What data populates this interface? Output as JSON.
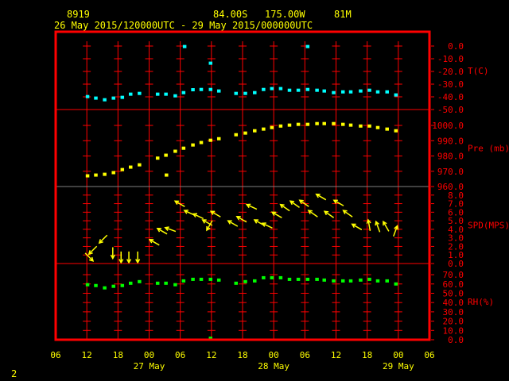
{
  "header": {
    "station": "8919",
    "latitude": "84.00S",
    "longitude": "175.00W",
    "elevation": "81M",
    "time_range": "26 May 2015/120000UTC - 29 May 2015/000000UTC"
  },
  "footer": {
    "page": "2"
  },
  "colors": {
    "frame": "#ff0000",
    "text": "#ffff00",
    "temp": "#00ffff",
    "pres": "#ffff00",
    "wind": "#ffff00",
    "rh": "#00ff00",
    "separator_gray": "#808080"
  },
  "chart_data": {
    "type": "scatter",
    "x_unit": "hours since 26 May 2015 06UTC",
    "xlim": [
      0,
      72
    ],
    "x_ticks": [
      0,
      6,
      12,
      18,
      24,
      30,
      36,
      42,
      48,
      54,
      60,
      66,
      72
    ],
    "x_tick_labels": [
      "06",
      "12",
      "18",
      "00",
      "06",
      "12",
      "18",
      "00",
      "06",
      "12",
      "18",
      "00",
      "06"
    ],
    "date_labels": [
      {
        "hour": 18,
        "label": "27 May"
      },
      {
        "hour": 42,
        "label": "28 May"
      },
      {
        "hour": 66,
        "label": "29 May"
      }
    ],
    "panels": [
      {
        "name": "temperature",
        "label": "T(C)",
        "ylim": [
          -50,
          11.25
        ],
        "color": "#00ffff",
        "ticks": [
          0,
          -10,
          -20,
          -30,
          -40,
          -50
        ],
        "tick_labels": [
          "0.0",
          "-10.0",
          "-20.0",
          "-30.0",
          "-40.0",
          "-50.0"
        ],
        "points": [
          [
            6.1,
            -39.8
          ],
          [
            7.7,
            -41
          ],
          [
            9.4,
            -42.3
          ],
          [
            11.1,
            -41
          ],
          [
            12.8,
            -40.4
          ],
          [
            14.4,
            -37.9
          ],
          [
            16.1,
            -37.3
          ],
          [
            19.6,
            -37.9
          ],
          [
            21.2,
            -37.9
          ],
          [
            23,
            -39.2
          ],
          [
            24.6,
            -36.7
          ],
          [
            26.4,
            -34.4
          ],
          [
            28,
            -34.2
          ],
          [
            29.8,
            -34.2
          ],
          [
            31.4,
            -35.4
          ],
          [
            34.7,
            -37.3
          ],
          [
            36.5,
            -37.3
          ],
          [
            38.3,
            -36.7
          ],
          [
            40,
            -34.2
          ],
          [
            41.6,
            -33.5
          ],
          [
            43.3,
            -33.5
          ],
          [
            45,
            -34.8
          ],
          [
            46.7,
            -34.8
          ],
          [
            48.5,
            -34.2
          ],
          [
            50.3,
            -34.8
          ],
          [
            51.7,
            -35.4
          ],
          [
            53.5,
            -36.7
          ],
          [
            55.3,
            -36.1
          ],
          [
            56.8,
            -36.1
          ],
          [
            58.7,
            -35.4
          ],
          [
            60.4,
            -34.8
          ],
          [
            62,
            -36.1
          ],
          [
            63.8,
            -36.1
          ],
          [
            65.5,
            -38.5
          ],
          [
            24.8,
            -0.4
          ],
          [
            29.8,
            -13.5
          ],
          [
            48.5,
            -0.4
          ]
        ]
      },
      {
        "name": "pressure",
        "label": "Pre (mb)",
        "ylim": [
          960,
          1010.4
        ],
        "color": "#ffff00",
        "ticks": [
          1000,
          990,
          980,
          970,
          960
        ],
        "tick_labels": [
          "1000.0",
          "990.0",
          "980.0",
          "970.0",
          "960.0"
        ],
        "points": [
          [
            6.1,
            967.0
          ],
          [
            7.7,
            967.5
          ],
          [
            9.4,
            968.0
          ],
          [
            11.1,
            969.1
          ],
          [
            12.8,
            971.1
          ],
          [
            14.4,
            972.7
          ],
          [
            16.1,
            974.2
          ],
          [
            19.6,
            978.6
          ],
          [
            21.2,
            980.5
          ],
          [
            23,
            983.1
          ],
          [
            24.6,
            985.1
          ],
          [
            26.4,
            987.2
          ],
          [
            28,
            988.8
          ],
          [
            29.8,
            990.3
          ],
          [
            31.4,
            991.3
          ],
          [
            34.7,
            993.9
          ],
          [
            36.5,
            995.0
          ],
          [
            38.3,
            996.5
          ],
          [
            40,
            997.6
          ],
          [
            41.6,
            998.6
          ],
          [
            43.3,
            999.6
          ],
          [
            45,
            1000.2
          ],
          [
            46.7,
            1000.7
          ],
          [
            48.5,
            1000.7
          ],
          [
            50.3,
            1001.2
          ],
          [
            51.7,
            1001.2
          ],
          [
            53.5,
            1001.2
          ],
          [
            55.3,
            1000.7
          ],
          [
            56.8,
            1000.2
          ],
          [
            58.7,
            999.6
          ],
          [
            60.4,
            999.6
          ],
          [
            62,
            998.6
          ],
          [
            63.8,
            997.6
          ],
          [
            65.5,
            996.5
          ],
          [
            21.3,
            967.5
          ]
        ]
      },
      {
        "name": "wind_speed",
        "label": "SPD(MPS)",
        "ylim": [
          0,
          9
        ],
        "color": "#ffff00",
        "ticks": [
          8,
          7,
          6,
          5,
          4,
          3,
          2,
          1,
          0
        ],
        "tick_labels": [
          "8.0",
          "7.0",
          "6.0",
          "5.0",
          "4.0",
          "3.0",
          "2.0",
          "1.0",
          "0.0"
        ],
        "points": [
          [
            6.4,
            1.1,
            225
          ],
          [
            8.4,
            2.4,
            225
          ],
          [
            7.2,
            0.3,
            135
          ],
          [
            11.0,
            0.6,
            180
          ],
          [
            12.6,
            0.1,
            180
          ],
          [
            14.1,
            0.1,
            180
          ],
          [
            15.8,
            0.1,
            180
          ],
          [
            18.1,
            2.8,
            300
          ],
          [
            19.6,
            4.1,
            300
          ],
          [
            21.1,
            4.2,
            290
          ],
          [
            23.0,
            7.3,
            300
          ],
          [
            24.8,
            6.2,
            295
          ],
          [
            26.5,
            5.8,
            295
          ],
          [
            28.3,
            5.1,
            300
          ],
          [
            29.1,
            3.9,
            210
          ],
          [
            29.9,
            6.1,
            300
          ],
          [
            33.2,
            5.0,
            300
          ],
          [
            34.9,
            5.5,
            300
          ],
          [
            36.8,
            6.9,
            295
          ],
          [
            38.3,
            5.1,
            300
          ],
          [
            39.8,
            4.7,
            295
          ],
          [
            41.7,
            6.0,
            300
          ],
          [
            43.3,
            6.9,
            305
          ],
          [
            45.2,
            7.3,
            305
          ],
          [
            47.0,
            7.4,
            305
          ],
          [
            48.7,
            6.2,
            305
          ],
          [
            50.2,
            8.1,
            300
          ],
          [
            51.8,
            6.1,
            305
          ],
          [
            53.6,
            7.4,
            300
          ],
          [
            55.4,
            6.2,
            305
          ],
          [
            57.1,
            4.6,
            300
          ],
          [
            60.2,
            5.1,
            350
          ],
          [
            61.7,
            4.9,
            340
          ],
          [
            63.1,
            4.9,
            330
          ],
          [
            65.8,
            4.4,
            20
          ]
        ]
      },
      {
        "name": "relative_humidity",
        "label": "RH(%)",
        "ylim": [
          0,
          82
        ],
        "color": "#00ff00",
        "ticks": [
          70,
          60,
          50,
          40,
          30,
          20,
          10,
          0
        ],
        "tick_labels": [
          "70.0",
          "60.0",
          "50.0",
          "40.0",
          "30.0",
          "20.0",
          "10.0",
          "0.0"
        ],
        "points": [
          [
            6.1,
            59.2
          ],
          [
            7.7,
            58.3
          ],
          [
            9.4,
            55.8
          ],
          [
            11.1,
            57.5
          ],
          [
            12.8,
            58.3
          ],
          [
            14.4,
            60.8
          ],
          [
            16.1,
            62.5
          ],
          [
            19.6,
            60.8
          ],
          [
            21.2,
            60.8
          ],
          [
            23,
            59.2
          ],
          [
            24.6,
            63.3
          ],
          [
            26.4,
            65
          ],
          [
            28,
            65
          ],
          [
            29.8,
            65
          ],
          [
            31.4,
            64.2
          ],
          [
            34.7,
            60.8
          ],
          [
            36.5,
            62.5
          ],
          [
            38.3,
            63.3
          ],
          [
            40,
            66.7
          ],
          [
            41.6,
            66.7
          ],
          [
            43.3,
            66.7
          ],
          [
            45,
            65
          ],
          [
            46.7,
            65
          ],
          [
            48.5,
            65
          ],
          [
            50.3,
            65
          ],
          [
            51.7,
            64.2
          ],
          [
            53.5,
            63.3
          ],
          [
            55.3,
            63.3
          ],
          [
            56.8,
            63.3
          ],
          [
            58.7,
            64.2
          ],
          [
            60.4,
            65
          ],
          [
            62,
            63.3
          ],
          [
            63.8,
            63.3
          ],
          [
            65.5,
            60
          ],
          [
            29.8,
            1.6
          ]
        ]
      }
    ]
  }
}
